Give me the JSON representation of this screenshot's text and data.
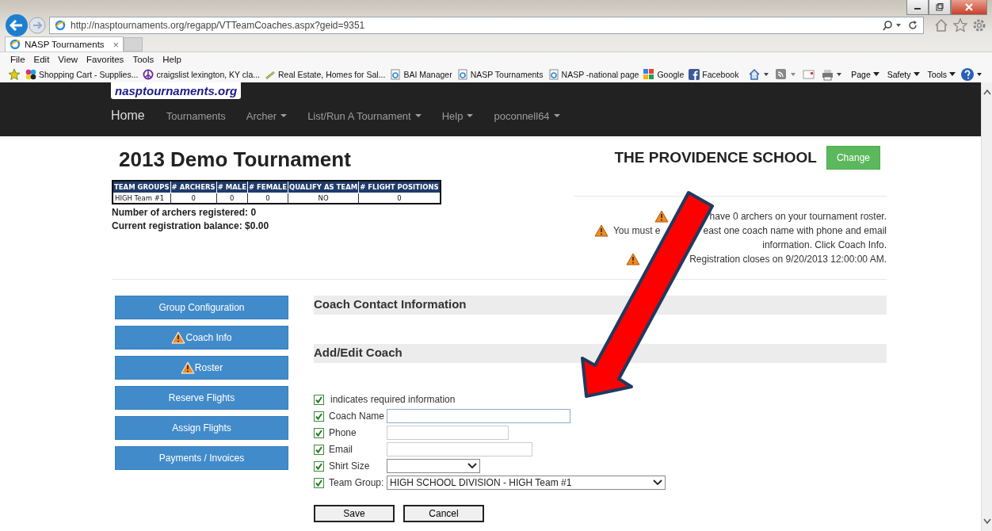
{
  "browser": {
    "url": "http://nasptournaments.org/regapp/VTTeamCoaches.aspx?geid=9351",
    "tab": {
      "title": "NASP Tournaments",
      "close": "×"
    },
    "menu": [
      "File",
      "Edit",
      "View",
      "Favorites",
      "Tools",
      "Help"
    ],
    "favorites": [
      {
        "label": "Shopping Cart - Supplies...",
        "kind": "cart"
      },
      {
        "label": "craigslist lexington, KY cla...",
        "kind": "peace"
      },
      {
        "label": "Real Estate, Homes for Sal...",
        "kind": "realestate"
      },
      {
        "label": "BAI Manager",
        "kind": "page"
      },
      {
        "label": "NASP Tournaments",
        "kind": "page"
      },
      {
        "label": "NASP -national page",
        "kind": "page"
      },
      {
        "label": "Google",
        "kind": "google"
      },
      {
        "label": "Facebook",
        "kind": "facebook"
      }
    ],
    "commands": [
      "Page",
      "Safety",
      "Tools"
    ]
  },
  "site": {
    "logo": "nasptournaments.org",
    "nav": [
      {
        "label": "Home",
        "kind": "home",
        "dropdown": false
      },
      {
        "label": "Tournaments",
        "kind": "link",
        "dropdown": false
      },
      {
        "label": "Archer",
        "kind": "link",
        "dropdown": true
      },
      {
        "label": "List/Run A Tournament",
        "kind": "link",
        "dropdown": true
      },
      {
        "label": "Help",
        "kind": "link",
        "dropdown": true
      },
      {
        "label": "poconnell64",
        "kind": "link",
        "dropdown": true
      }
    ]
  },
  "tournament": {
    "title": "2013 Demo Tournament",
    "school": "THE PROVIDENCE SCHOOL",
    "change_button": "Change"
  },
  "table": {
    "columns": [
      "TEAM GROUPS",
      "# ARCHERS",
      "# MALE",
      "# FEMALE",
      "QUALIFY AS TEAM",
      "# FLIGHT POSITIONS"
    ],
    "rows": [
      [
        "HIGH Team #1",
        "0",
        "0",
        "0",
        "NO",
        "0"
      ]
    ]
  },
  "summary": [
    "Number of archers registered: 0",
    "Current registration balance: $0.00"
  ],
  "warnings": [
    {
      "parts": [
        "have 0 archers on your tournament roster."
      ],
      "icon": true
    },
    {
      "parts": [
        "You must e",
        "east one coach name with phone and email"
      ],
      "icon": true
    },
    {
      "parts": [
        "information. Click Coach Info."
      ],
      "icon": false
    },
    {
      "parts": [
        "Registration closes on 9/20/2013 12:00:00 AM."
      ],
      "icon": true
    }
  ],
  "sidebar": [
    {
      "label": "Group Configuration",
      "warning": false
    },
    {
      "label": "Coach Info",
      "warning": true
    },
    {
      "label": "Roster",
      "warning": true
    },
    {
      "label": "Reserve Flights",
      "warning": false
    },
    {
      "label": "Assign Flights",
      "warning": false
    },
    {
      "label": "Payments / Invoices",
      "warning": false
    }
  ],
  "sections": [
    "Coach Contact Information",
    "Add/Edit Coach"
  ],
  "form": {
    "legend": {
      "text": "indicates required information",
      "checked": true
    },
    "fields": [
      {
        "label": "Coach Name",
        "kind": "text",
        "checked": true
      },
      {
        "label": "Phone",
        "kind": "text",
        "checked": true
      },
      {
        "label": "Email",
        "kind": "text",
        "checked": true
      },
      {
        "label": "Shirt Size",
        "kind": "select",
        "checked": true
      },
      {
        "label": "Team Group:",
        "kind": "select",
        "value": "HIGH SCHOOL DIVISION - HIGH Team #1",
        "checked": true
      }
    ],
    "buttons": [
      "Save",
      "Cancel"
    ]
  }
}
